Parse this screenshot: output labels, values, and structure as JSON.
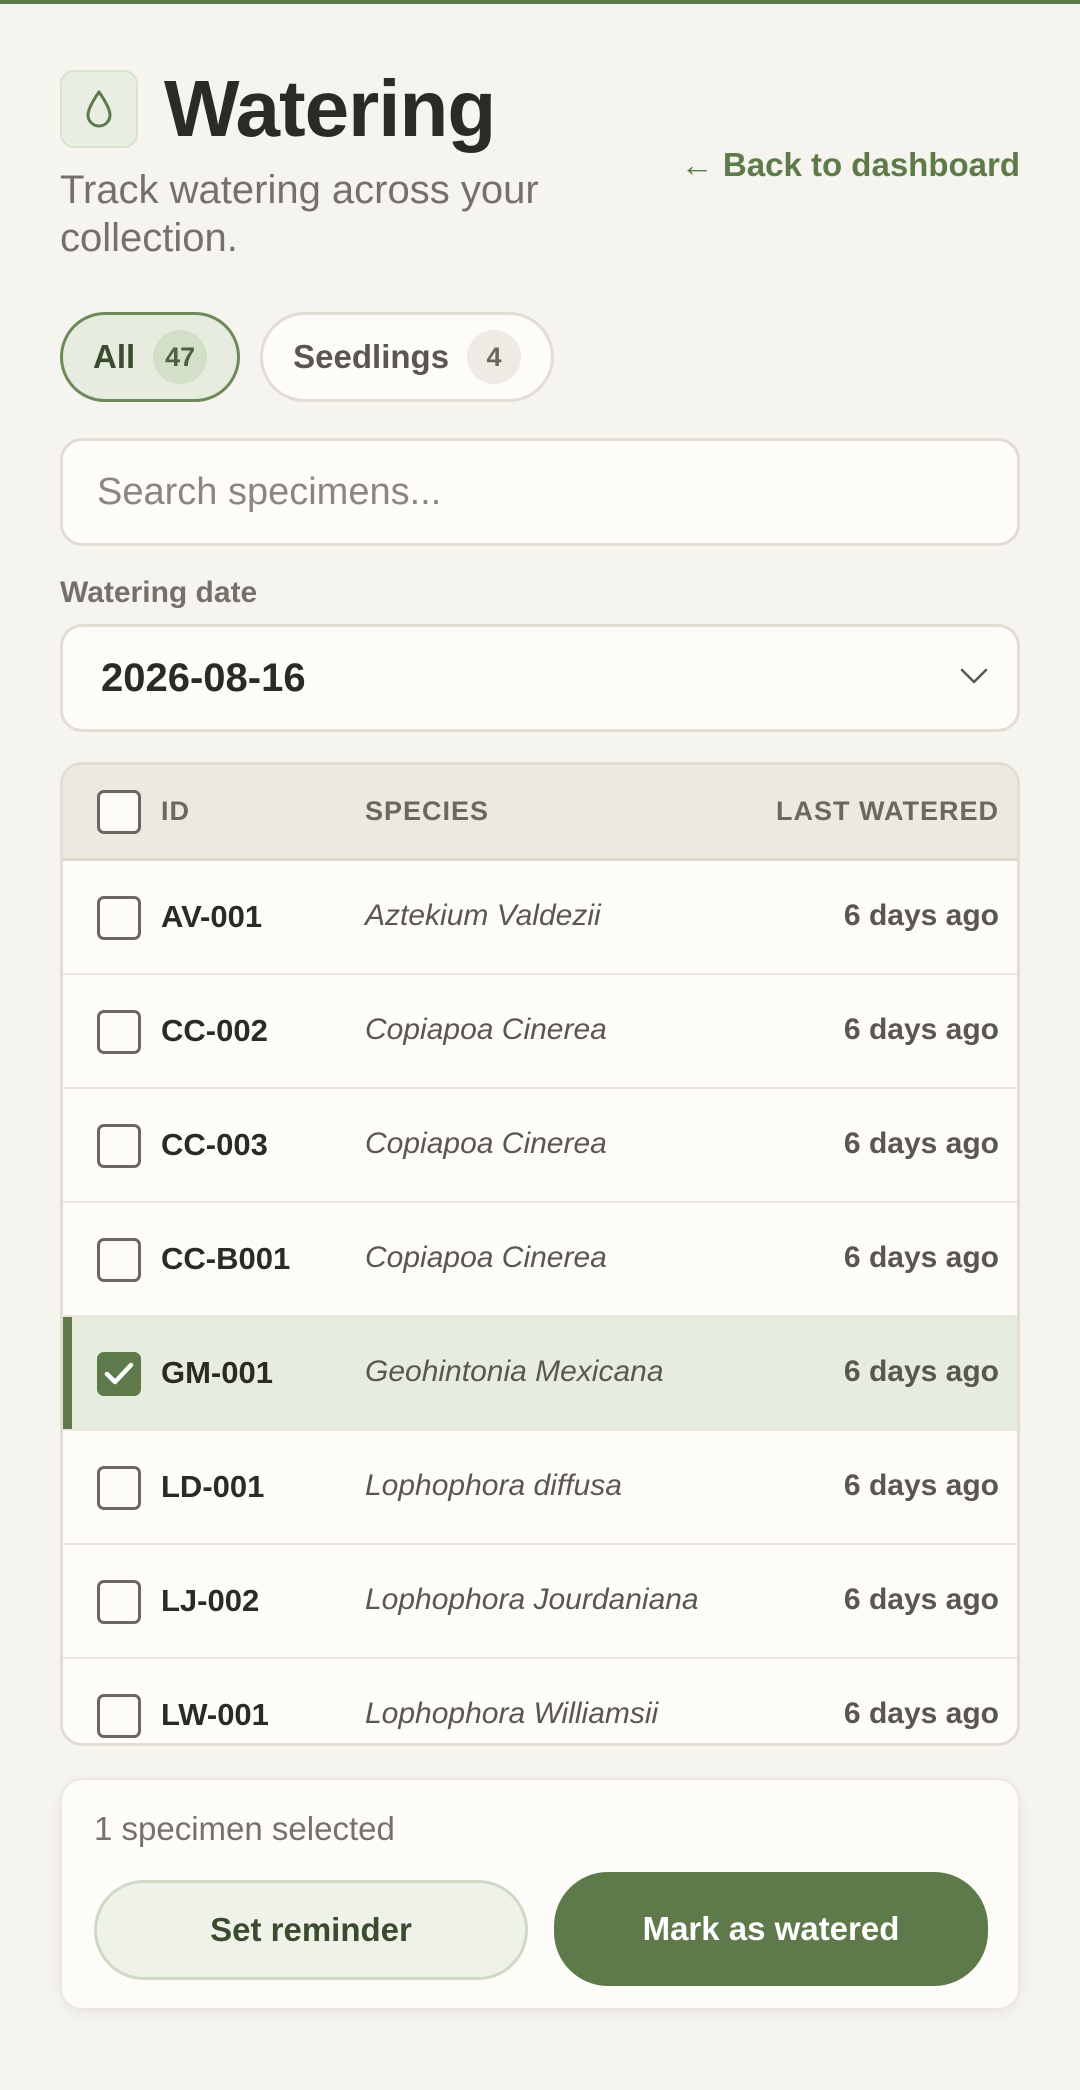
{
  "header": {
    "title": "Watering",
    "subtitle": "Track watering across your collection.",
    "back_link": "← Back to dashboard"
  },
  "filters": [
    {
      "label": "All",
      "count": "47",
      "active": true
    },
    {
      "label": "Seedlings",
      "count": "4",
      "active": false
    }
  ],
  "search": {
    "placeholder": "Search specimens...",
    "value": ""
  },
  "date": {
    "label": "Watering date",
    "value": "2026-08-16"
  },
  "table": {
    "columns": {
      "id": "ID",
      "species": "SPECIES",
      "last_watered": "LAST WATERED"
    },
    "rows": [
      {
        "id": "AV-001",
        "species": "Aztekium Valdezii",
        "last_watered": "6 days ago",
        "selected": false
      },
      {
        "id": "CC-002",
        "species": "Copiapoa Cinerea",
        "last_watered": "6 days ago",
        "selected": false
      },
      {
        "id": "CC-003",
        "species": "Copiapoa Cinerea",
        "last_watered": "6 days ago",
        "selected": false
      },
      {
        "id": "CC-B001",
        "species": "Copiapoa Cinerea",
        "last_watered": "6 days ago",
        "selected": false
      },
      {
        "id": "GM-001",
        "species": "Geohintonia Mexicana",
        "last_watered": "6 days ago",
        "selected": true
      },
      {
        "id": "LD-001",
        "species": "Lophophora diffusa",
        "last_watered": "6 days ago",
        "selected": false
      },
      {
        "id": "LJ-002",
        "species": "Lophophora Jourdaniana",
        "last_watered": "6 days ago",
        "selected": false
      },
      {
        "id": "LW-001",
        "species": "Lophophora Williamsii",
        "last_watered": "6 days ago",
        "selected": false
      }
    ]
  },
  "actions": {
    "selected_count": "1 specimen selected",
    "reminder_label": "Set reminder",
    "watered_label": "Mark as watered"
  },
  "colors": {
    "accent": "#5e7a4a",
    "background": "#f6f4ee",
    "selected_row": "#e6eddf"
  },
  "icons": {
    "header": "water-drop-icon",
    "date": "chevron-down-icon",
    "checkbox": "check-icon"
  }
}
